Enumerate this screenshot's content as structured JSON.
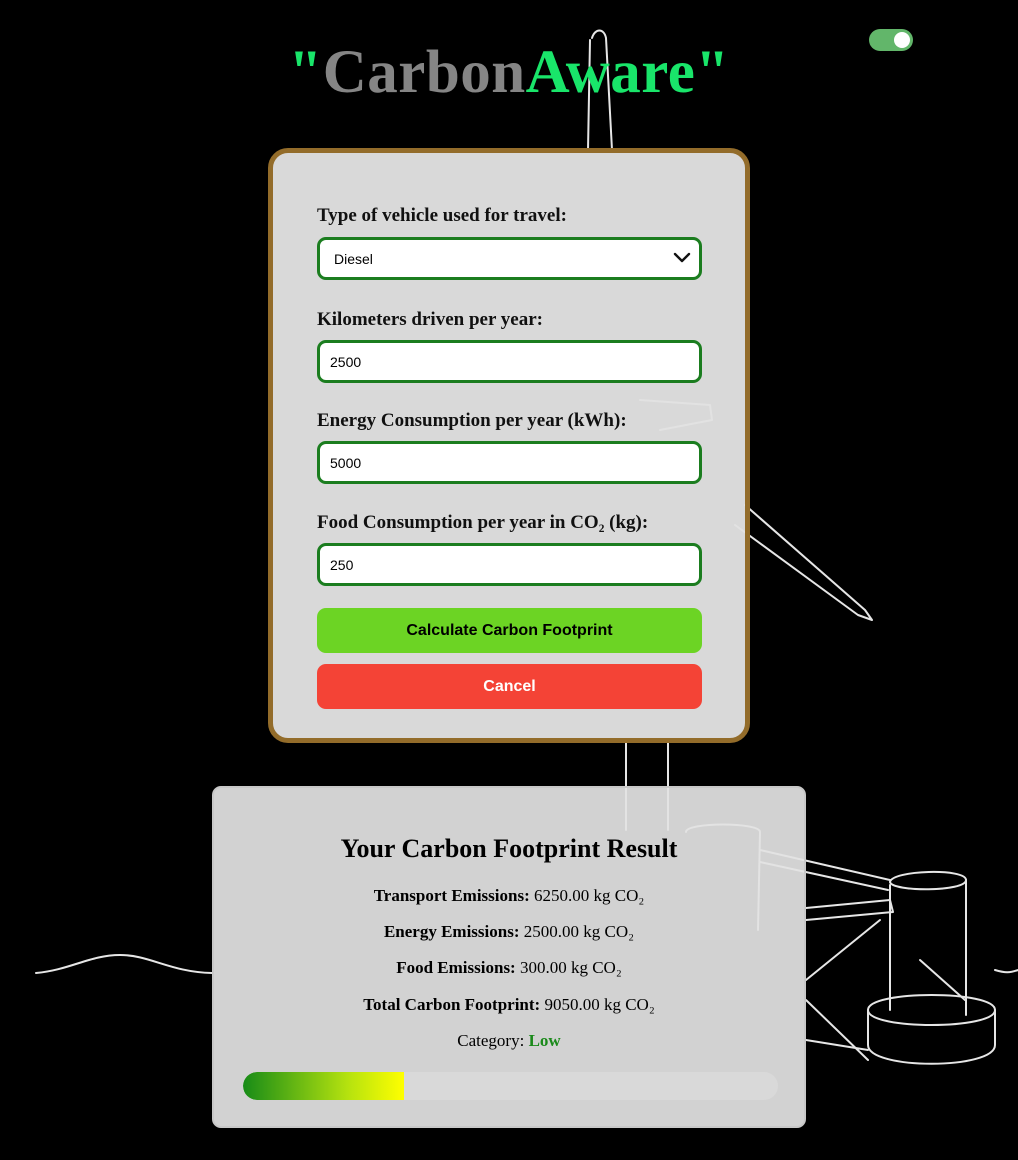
{
  "header": {
    "quote_open": "\"",
    "title_part1": "Carbon",
    "title_part2": "Aware",
    "quote_close": "\""
  },
  "theme_toggle": {
    "state": "on",
    "color": "#62b66a"
  },
  "form": {
    "vehicle_label": "Type of vehicle used for travel:",
    "vehicle_value": "Diesel",
    "km_label": "Kilometers driven per year:",
    "km_value": "2500",
    "energy_label": "Energy Consumption per year (kWh):",
    "energy_value": "5000",
    "food_label": "Food Consumption per year in CO₂ (kg):",
    "food_value": "250",
    "calculate_label": "Calculate Carbon Footprint",
    "cancel_label": "Cancel"
  },
  "result": {
    "title": "Your Carbon Footprint Result",
    "transport_label": "Transport Emissions:",
    "transport_value": "6250.00 kg CO₂",
    "energy_label": "Energy Emissions:",
    "energy_value": "2500.00 kg CO₂",
    "food_label": "Food Emissions:",
    "food_value": "300.00 kg CO₂",
    "total_label": "Total Carbon Footprint:",
    "total_value": "9050.00 kg CO₂",
    "category_label": "Category:",
    "category_value": "Low",
    "meter_fraction": 0.3
  },
  "colors": {
    "accent_green": "#19e56a",
    "title_gray": "#858585",
    "card_border": "#936c2a",
    "input_border": "#1b7d1f",
    "calc_button": "#6cd424",
    "cancel_button": "#f44336",
    "category_low": "#1b8a1b"
  }
}
